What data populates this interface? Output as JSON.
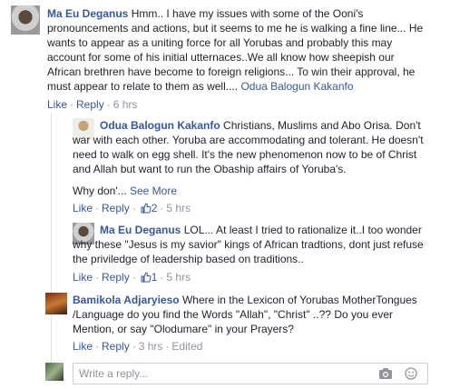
{
  "comments": [
    {
      "author": "Ma Eu Deganus",
      "text": "Hmm.. I have my issues with some of the Ooni's pronouncements and actions, but it seems to me he is walking a fine line... He wants to appear as a uniting force for all Yorubas and probably this may account for some of his initial utternaces..We all know how sheepish our African brethren have become to foreign religions... To win their approval, he must appear to relate to them as well.... ",
      "mention": "Odua Balogun Kakanfo",
      "actions": {
        "like": "Like",
        "reply": "Reply",
        "time": "6 hrs"
      }
    },
    {
      "author": "Odua Balogun Kakanfo",
      "text": "Christians, Muslims and Abo Orisa. Don't war with each other. Yoruba are accommodating and tolerant. He doesn't need to walk on egg shell. It's the new phenomenon now to be of Christ and Allah but want to run the Obaship affairs of Yoruba's.",
      "truncated": "Why don'...",
      "see_more": "See More",
      "actions": {
        "like": "Like",
        "reply": "Reply",
        "likes": "2",
        "time": "5 hrs"
      }
    },
    {
      "author": "Ma Eu Deganus",
      "text": "LOL... At least I tried to rationalize it..I too wonder why these \"Jesus is my savior\" kings of African tradtions, dont just refuse the priviledge of leadership based on traditions..",
      "actions": {
        "like": "Like",
        "reply": "Reply",
        "likes": "1",
        "time": "5 hrs"
      }
    },
    {
      "author": "Bamikola Adjaryieso",
      "text": "Where in the Lexicon of Yorubas MotherTongues /Language do you find the Words \"Allah\", \"Christ\" ..?? Do you ever Mention, or say \"Olodumare\" in your Prayers?",
      "actions": {
        "like": "Like",
        "reply": "Reply",
        "time": "3 hrs",
        "edited": "Edited"
      }
    }
  ],
  "reply_box": {
    "placeholder": "Write a reply..."
  },
  "colors": {
    "link": "#365899",
    "meta": "#90949c",
    "text": "#1d2129",
    "border": "#ccd0d5"
  },
  "icons": [
    "thumbs-up-icon",
    "camera-icon",
    "emoji-icon"
  ]
}
